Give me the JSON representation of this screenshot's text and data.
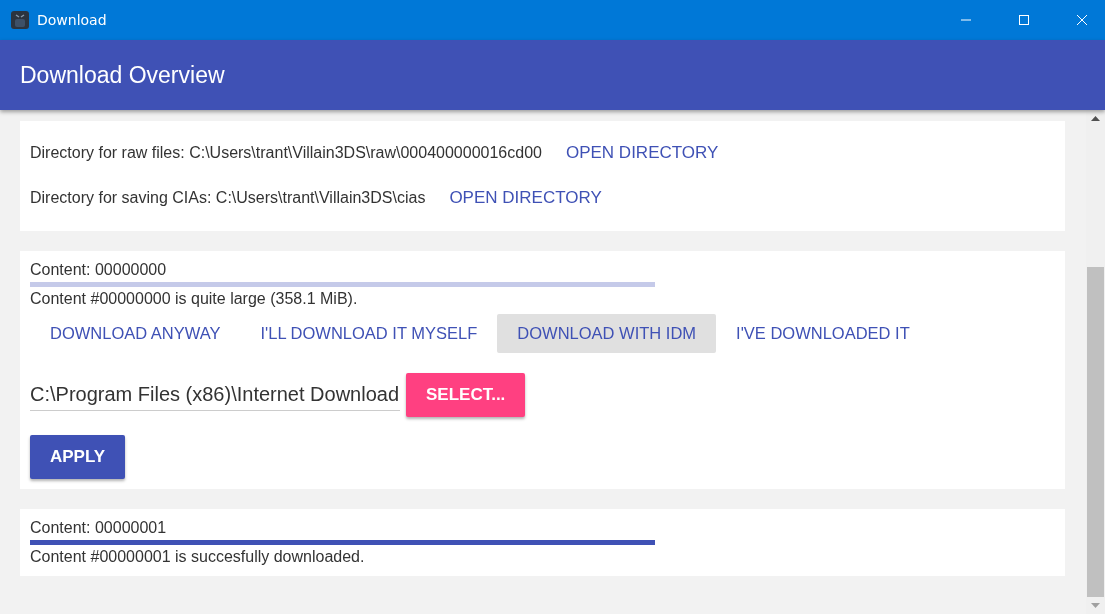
{
  "window": {
    "title": "Download"
  },
  "app_bar": {
    "title": "Download Overview"
  },
  "directories": [
    {
      "label": "Directory for raw files: C:\\Users\\trant\\Villain3DS\\raw\\000400000016cd00",
      "action": "OPEN DIRECTORY"
    },
    {
      "label": "Directory for saving CIAs: C:\\Users\\trant\\Villain3DS\\cias",
      "action": "OPEN DIRECTORY"
    }
  ],
  "contents": [
    {
      "title": "Content: 00000000",
      "level": 0,
      "message": "Content #00000000 is quite large (358.1 MiB).",
      "options": [
        {
          "label": "DOWNLOAD ANYWAY",
          "selected": false
        },
        {
          "label": "I'LL DOWNLOAD IT MYSELF",
          "selected": false
        },
        {
          "label": "DOWNLOAD WITH IDM",
          "selected": true
        },
        {
          "label": "I'VE DOWNLOADED IT",
          "selected": false
        }
      ],
      "path_value": "C:\\Program Files (x86)\\Internet Download",
      "select_button": "SELECT...",
      "apply_button": "APPLY"
    },
    {
      "title": "Content: 00000001",
      "level": 1,
      "message": "Content #00000001 is succesfully downloaded."
    }
  ]
}
